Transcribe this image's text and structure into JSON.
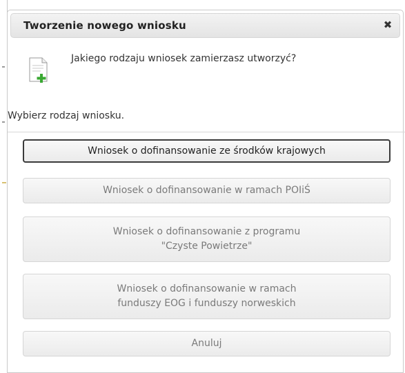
{
  "dialog": {
    "title": "Tworzenie nowego wniosku",
    "close_glyph": "✖",
    "question": "Jakiego rodzaju wniosek zamierzasz utworzyć?",
    "instruction": "Wybierz rodzaj wniosku.",
    "icon": "document-add-icon"
  },
  "buttons": [
    {
      "line1": "Wniosek o dofinansowanie ze środków krajowych",
      "line2": ""
    },
    {
      "line1": "Wniosek o dofinansowanie w ramach POIiŚ",
      "line2": ""
    },
    {
      "line1": "Wniosek o dofinansowanie z programu",
      "line2": "\"Czyste Powietrze\""
    },
    {
      "line1": "Wniosek o dofinansowanie w ramach",
      "line2": "funduszy EOG i funduszy norweskich"
    },
    {
      "line1": "Anuluj",
      "line2": ""
    }
  ],
  "colors": {
    "accent_plus": "#3aa832",
    "primary_border": "#3a3a3a"
  }
}
